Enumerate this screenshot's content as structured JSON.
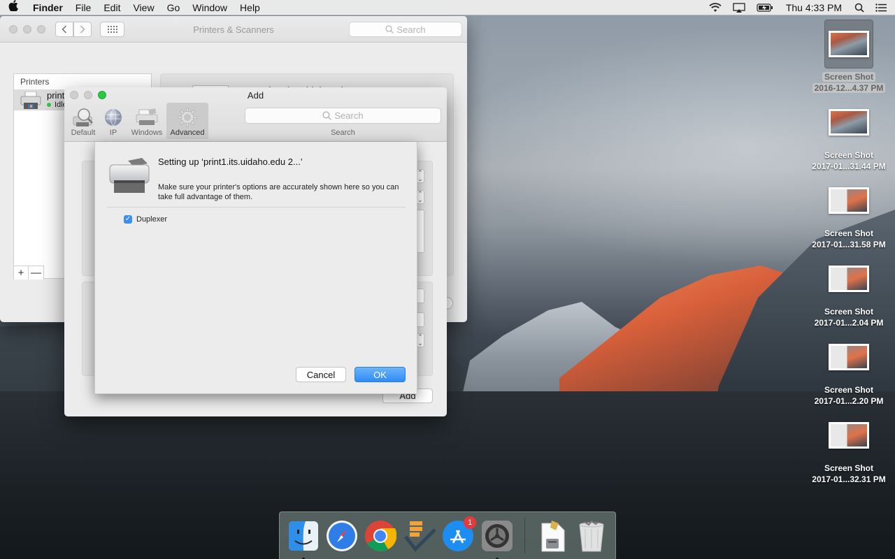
{
  "menubar": {
    "apple": "",
    "app_name": "Finder",
    "menus": [
      "File",
      "Edit",
      "View",
      "Go",
      "Window",
      "Help"
    ],
    "clock": "Thu 4:33 PM",
    "status_icons": [
      "wifi-icon",
      "airplay-icon",
      "battery-charging-icon",
      "spotlight-search-icon",
      "notification-center-icon"
    ]
  },
  "prefs_window": {
    "title": "Printers & Scanners",
    "search_placeholder": "Search",
    "printers_header": "Printers",
    "printers": [
      {
        "name": "print1.its.uidaho.edu",
        "status": "Idle",
        "status_color": "#34c84a"
      }
    ],
    "list_controls": {
      "add": "+",
      "remove": "—"
    },
    "detail": {
      "printer_name": "print1.its.uidaho.edu"
    }
  },
  "add_window": {
    "title": "Add",
    "toolbar": [
      {
        "label": "Default",
        "icon": "default-printer-icon",
        "active": false
      },
      {
        "label": "IP",
        "icon": "ip-globe-icon",
        "active": false
      },
      {
        "label": "Windows",
        "icon": "windows-printer-icon",
        "active": false
      },
      {
        "label": "Advanced",
        "icon": "advanced-gear-icon",
        "active": true
      }
    ],
    "search_placeholder": "Search",
    "search_label": "Search",
    "add_button": "Add"
  },
  "setup_sheet": {
    "title": "Setting up ‘print1.its.uidaho.edu 2...’",
    "message": "Make sure your printer's options are accurately shown here so you can take full advantage of them.",
    "options": [
      {
        "label": "Duplexer",
        "checked": true
      }
    ],
    "cancel_label": "Cancel",
    "ok_label": "OK",
    "accent_color": "#3a8ff5"
  },
  "desktop_icons": [
    {
      "line1": "Screen Shot",
      "line2": "2016-12...4.37 PM",
      "selected": true
    },
    {
      "line1": "Screen Shot",
      "line2": "2017-01...31.44 PM",
      "selected": false
    },
    {
      "line1": "Screen Shot",
      "line2": "2017-01...31.58 PM",
      "selected": false
    },
    {
      "line1": "Screen Shot",
      "line2": "2017-01...2.04 PM",
      "selected": false
    },
    {
      "line1": "Screen Shot",
      "line2": "2017-01...2.20 PM",
      "selected": false
    },
    {
      "line1": "Screen Shot",
      "line2": "2017-01...32.31 PM",
      "selected": false
    }
  ],
  "dock": {
    "apps": [
      {
        "name": "Finder",
        "icon": "finder-icon",
        "running": true
      },
      {
        "name": "Safari",
        "icon": "safari-icon",
        "running": false
      },
      {
        "name": "Google Chrome",
        "icon": "chrome-icon",
        "running": false
      },
      {
        "name": "Tasks",
        "icon": "tasks-checkmark-icon",
        "running": false
      },
      {
        "name": "App Store",
        "icon": "app-store-icon",
        "running": false,
        "badge": "1"
      },
      {
        "name": "System Preferences",
        "icon": "system-preferences-icon",
        "running": true
      }
    ],
    "others": [
      {
        "name": "Installer Package",
        "icon": "installer-package-icon"
      },
      {
        "name": "Trash",
        "icon": "trash-icon"
      }
    ]
  }
}
